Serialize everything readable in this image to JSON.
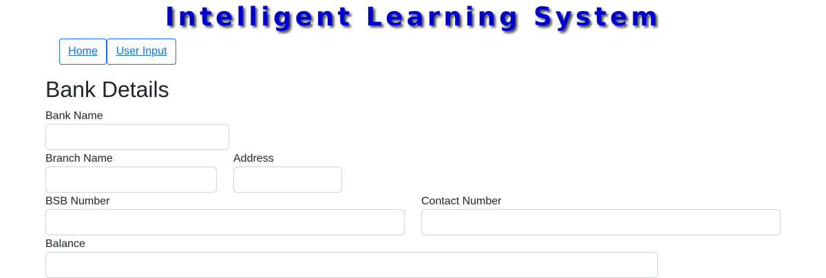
{
  "header": {
    "title": "Intelligent Learning System"
  },
  "nav": {
    "home": "Home",
    "user_input": "User Input"
  },
  "form": {
    "title": "Bank Details",
    "fields": {
      "bank_name": {
        "label": "Bank Name",
        "value": ""
      },
      "branch_name": {
        "label": "Branch Name",
        "value": ""
      },
      "address": {
        "label": "Address",
        "value": ""
      },
      "bsb_number": {
        "label": "BSB Number",
        "value": ""
      },
      "contact_number": {
        "label": "Contact Number",
        "value": ""
      },
      "balance": {
        "label": "Balance",
        "value": ""
      }
    }
  },
  "colors": {
    "title_text": "#0000cc",
    "link": "#0d6efd",
    "input_border": "#ced4da"
  }
}
